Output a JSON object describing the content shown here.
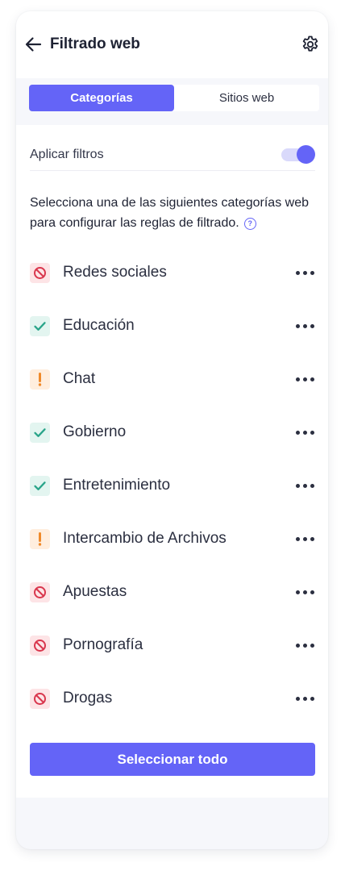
{
  "header": {
    "title": "Filtrado web",
    "back_icon": "arrow-left-icon",
    "settings_icon": "gear-icon"
  },
  "tabs": [
    {
      "label": "Categorías",
      "active": true
    },
    {
      "label": "Sitios web",
      "active": false
    }
  ],
  "filters": {
    "label": "Aplicar filtros",
    "enabled": true
  },
  "description": "Selecciona una de las siguientes categorías web para configurar las reglas de filtrado.",
  "categories": [
    {
      "label": "Redes sociales",
      "status": "blocked",
      "icon": "block-icon"
    },
    {
      "label": "Educación",
      "status": "allowed",
      "icon": "check-icon"
    },
    {
      "label": "Chat",
      "status": "warning",
      "icon": "exclamation-icon"
    },
    {
      "label": "Gobierno",
      "status": "allowed",
      "icon": "check-icon"
    },
    {
      "label": "Entretenimiento",
      "status": "allowed",
      "icon": "check-icon"
    },
    {
      "label": "Intercambio de Archivos",
      "status": "warning",
      "icon": "exclamation-icon"
    },
    {
      "label": "Apuestas",
      "status": "blocked",
      "icon": "block-icon"
    },
    {
      "label": "Pornografía",
      "status": "blocked",
      "icon": "block-icon"
    },
    {
      "label": "Drogas",
      "status": "blocked",
      "icon": "block-icon"
    }
  ],
  "select_all_label": "Seleccionar todo",
  "colors": {
    "accent": "#6464f7",
    "blocked": "#d9364d",
    "allowed": "#2aa58a",
    "warning": "#f08a2a"
  }
}
